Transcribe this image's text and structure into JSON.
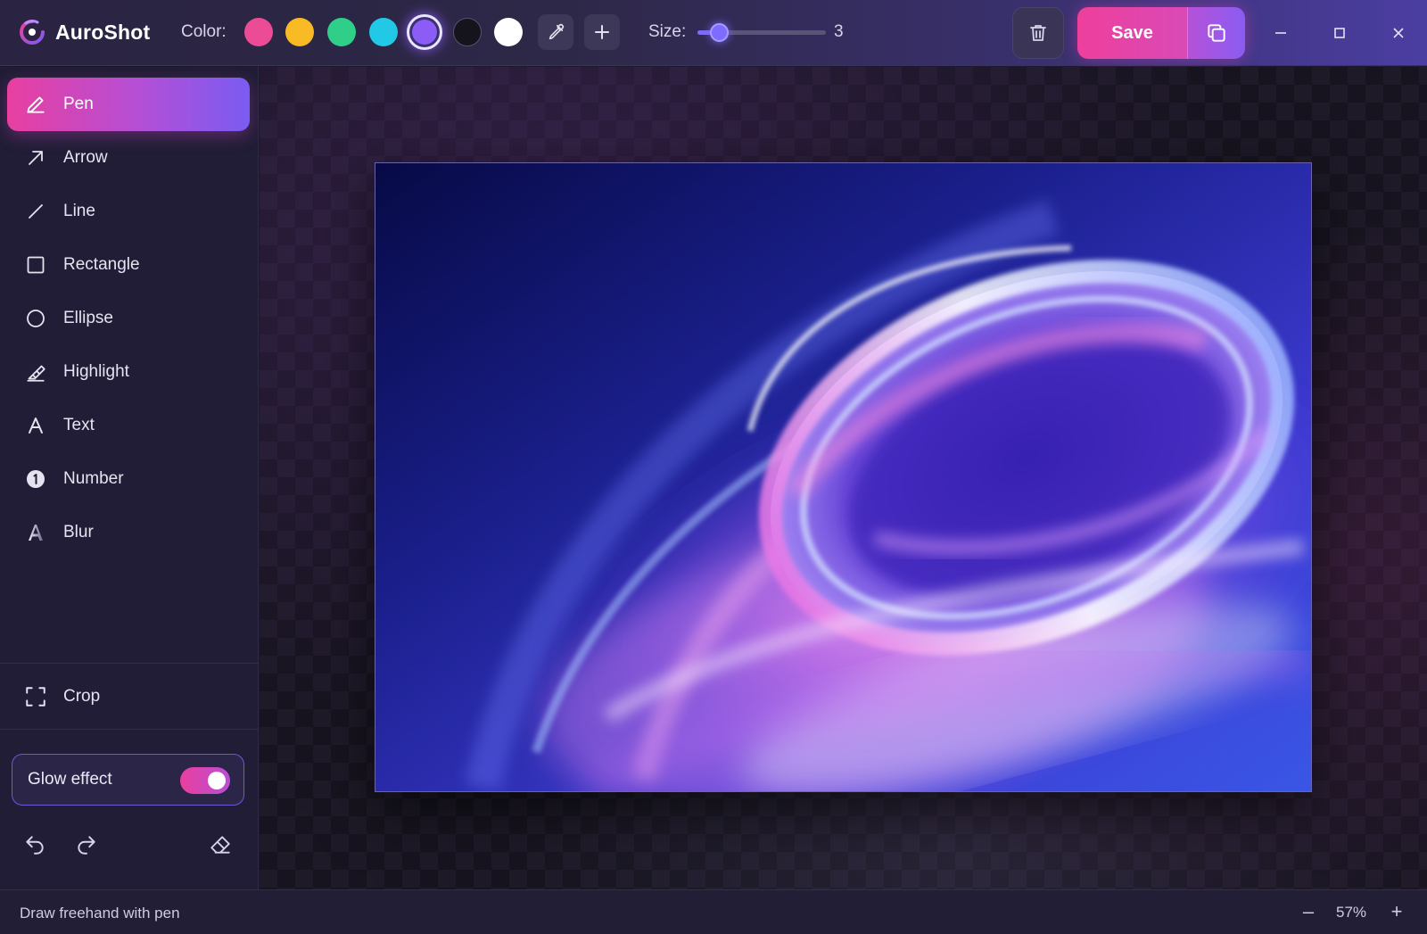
{
  "app": {
    "name": "AuroShot"
  },
  "toolbar": {
    "color_label": "Color:",
    "colors": [
      {
        "name": "pink",
        "hex": "#ec4c95"
      },
      {
        "name": "amber",
        "hex": "#f8bb26"
      },
      {
        "name": "green",
        "hex": "#2fcf8a"
      },
      {
        "name": "cyan",
        "hex": "#22c9e6"
      },
      {
        "name": "violet",
        "hex": "#8b5cf6",
        "selected": true
      },
      {
        "name": "black",
        "hex": "#15131c"
      },
      {
        "name": "white",
        "hex": "#ffffff"
      }
    ],
    "eyedropper_icon": "eyedropper-icon",
    "add_color_icon": "plus-icon",
    "size_label": "Size:",
    "size_value": "3",
    "size_fraction": 0.17,
    "trash_icon": "trash-icon",
    "save_label": "Save",
    "copy_icon": "copy-icon"
  },
  "window_controls": [
    "minimize-icon",
    "maximize-icon",
    "close-icon"
  ],
  "sidebar": {
    "tools": [
      {
        "id": "pen",
        "label": "Pen",
        "icon": "pen-icon",
        "active": true
      },
      {
        "id": "arrow",
        "label": "Arrow",
        "icon": "arrow-icon"
      },
      {
        "id": "line",
        "label": "Line",
        "icon": "line-icon"
      },
      {
        "id": "rectangle",
        "label": "Rectangle",
        "icon": "rectangle-icon"
      },
      {
        "id": "ellipse",
        "label": "Ellipse",
        "icon": "ellipse-icon"
      },
      {
        "id": "highlight",
        "label": "Highlight",
        "icon": "highlighter-icon"
      },
      {
        "id": "text",
        "label": "Text",
        "icon": "text-icon"
      },
      {
        "id": "number",
        "label": "Number",
        "icon": "number-badge-icon"
      },
      {
        "id": "blur",
        "label": "Blur",
        "icon": "blur-icon"
      }
    ],
    "crop": {
      "label": "Crop",
      "icon": "crop-icon"
    },
    "glow": {
      "label": "Glow effect",
      "enabled": true
    },
    "bottom_icons": [
      "undo-icon",
      "redo-icon",
      "eraser-icon"
    ]
  },
  "canvas": {
    "image_description_icon": "abstract-swirl-image",
    "colors": {
      "bg_dark": "#0c0a55",
      "violet": "#6a4cf0",
      "pink": "#e57ae6"
    }
  },
  "status": {
    "text": "Draw freehand with pen",
    "zoom": "57%",
    "zoom_out_symbol": "–",
    "zoom_in_symbol": "+"
  }
}
